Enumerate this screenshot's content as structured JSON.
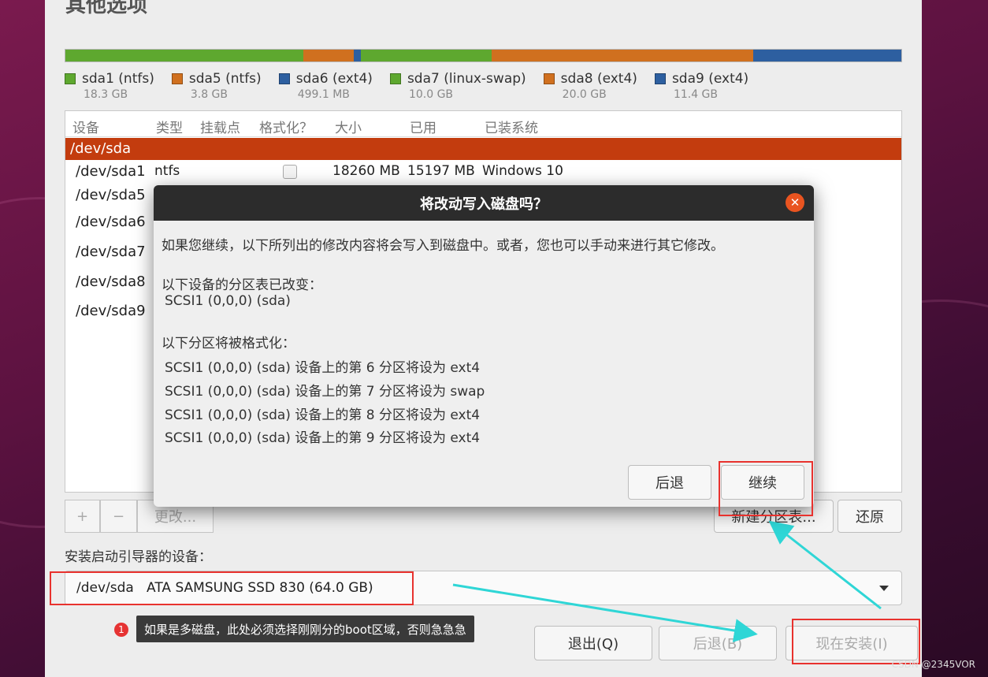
{
  "window": {
    "title": "其他选项"
  },
  "partitions": [
    {
      "name": "sda1 (ntfs)",
      "size": "18.3 GB",
      "color": "#5ea82f",
      "share": 0.285
    },
    {
      "name": "sda5 (ntfs)",
      "size": "3.8 GB",
      "color": "#d0701f",
      "share": 0.06
    },
    {
      "name": "sda6 (ext4)",
      "size": "499.1 MB",
      "color": "#2d5fa0",
      "share": 0.008
    },
    {
      "name": "sda7 (linux-swap)",
      "size": "10.0 GB",
      "color": "#5ea82f",
      "share": 0.157
    },
    {
      "name": "sda8 (ext4)",
      "size": "20.0 GB",
      "color": "#d0701f",
      "share": 0.313
    },
    {
      "name": "sda9 (ext4)",
      "size": "11.4 GB",
      "color": "#2d5fa0",
      "share": 0.177
    }
  ],
  "table": {
    "headers": [
      "设备",
      "类型",
      "挂载点",
      "格式化？",
      "大小",
      "已用",
      "已装系统"
    ],
    "selected_row": "/dev/sda",
    "first_row": {
      "device": "/dev/sda1",
      "type": "ntfs",
      "size": "18260 MB",
      "used": "15197 MB",
      "system": "Windows 10"
    },
    "other_devices": [
      "/dev/sda5",
      "/dev/sda6",
      "/dev/sda7",
      "/dev/sda8",
      "/dev/sda9"
    ]
  },
  "toolbar": {
    "add": "+",
    "remove": "−",
    "change": "更改...",
    "new_table": "新建分区表...",
    "revert": "还原"
  },
  "boot": {
    "label": "安装启动引导器的设备：",
    "value": "/dev/sda   ATA SAMSUNG SSD 830 (64.0 GB)"
  },
  "bottom": {
    "quit": "退出(Q)",
    "back": "后退(B)",
    "install": "现在安装(I)"
  },
  "dialog": {
    "title": "将改动写入磁盘吗？",
    "close": "✕",
    "intro": "如果您继续，以下所列出的修改内容将会写入到磁盘中。或者，您也可以手动来进行其它修改。",
    "table_changed_label": "以下设备的分区表已改变：",
    "table_changed_device": "SCSI1 (0,0,0) (sda)",
    "format_label": "以下分区将被格式化：",
    "format_items": [
      "SCSI1 (0,0,0) (sda) 设备上的第 6 分区将设为 ext4",
      "SCSI1 (0,0,0) (sda) 设备上的第 7 分区将设为 swap",
      "SCSI1 (0,0,0) (sda) 设备上的第 8 分区将设为 ext4",
      "SCSI1 (0,0,0) (sda) 设备上的第 9 分区将设为 ext4"
    ],
    "back": "后退",
    "continue": "继续"
  },
  "annotation": {
    "badge": "1",
    "text": "如果是多磁盘，此处必须选择刚刚分的boot区域，否则急急急"
  },
  "watermark": "CSDN @2345VOR"
}
